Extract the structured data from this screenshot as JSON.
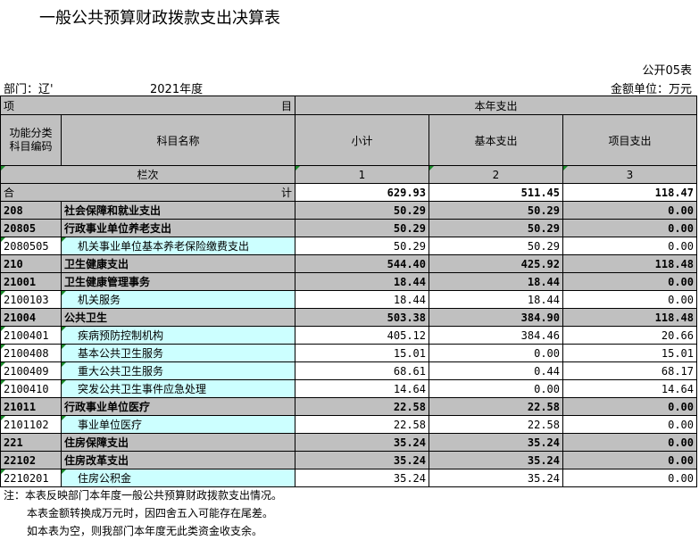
{
  "title": "一般公共预算财政拨款支出决算表",
  "public_no": "公开05表",
  "dept": "部门：辽'",
  "year": "2021年度",
  "unit": "金额单位：万元",
  "header": {
    "xiang": "项",
    "mu": "目",
    "current_year": "本年支出",
    "func_code_line1": "功能分类",
    "func_code_line2": "科目编码",
    "subject_name": "科目名称",
    "subtotal": "小计",
    "basic": "基本支出",
    "project": "项目支出",
    "lanci": "栏次",
    "col1": "1",
    "col2": "2",
    "col3": "3"
  },
  "total": {
    "he": "合",
    "ji": "计",
    "subtotal": "629.93",
    "basic": "511.45",
    "project": "118.47"
  },
  "rows": [
    {
      "code": "208",
      "name": "社会保障和就业支出",
      "subtotal": "50.29",
      "basic": "50.29",
      "project": "0.00",
      "level": 1
    },
    {
      "code": "20805",
      "name": "行政事业单位养老支出",
      "subtotal": "50.29",
      "basic": "50.29",
      "project": "0.00",
      "level": 2
    },
    {
      "code": "2080505",
      "name": "机关事业单位基本养老保险缴费支出",
      "subtotal": "50.29",
      "basic": "50.29",
      "project": "0.00",
      "level": 3
    },
    {
      "code": "210",
      "name": "卫生健康支出",
      "subtotal": "544.40",
      "basic": "425.92",
      "project": "118.48",
      "level": 1
    },
    {
      "code": "21001",
      "name": "卫生健康管理事务",
      "subtotal": "18.44",
      "basic": "18.44",
      "project": "0.00",
      "level": 2
    },
    {
      "code": "2100103",
      "name": "机关服务",
      "subtotal": "18.44",
      "basic": "18.44",
      "project": "0.00",
      "level": 3
    },
    {
      "code": "21004",
      "name": "公共卫生",
      "subtotal": "503.38",
      "basic": "384.90",
      "project": "118.48",
      "level": 2
    },
    {
      "code": "2100401",
      "name": "疾病预防控制机构",
      "subtotal": "405.12",
      "basic": "384.46",
      "project": "20.66",
      "level": 3
    },
    {
      "code": "2100408",
      "name": "基本公共卫生服务",
      "subtotal": "15.01",
      "basic": "0.00",
      "project": "15.01",
      "level": 3
    },
    {
      "code": "2100409",
      "name": "重大公共卫生服务",
      "subtotal": "68.61",
      "basic": "0.44",
      "project": "68.17",
      "level": 3
    },
    {
      "code": "2100410",
      "name": "突发公共卫生事件应急处理",
      "subtotal": "14.64",
      "basic": "0.00",
      "project": "14.64",
      "level": 3
    },
    {
      "code": "21011",
      "name": "行政事业单位医疗",
      "subtotal": "22.58",
      "basic": "22.58",
      "project": "0.00",
      "level": 2
    },
    {
      "code": "2101102",
      "name": "事业单位医疗",
      "subtotal": "22.58",
      "basic": "22.58",
      "project": "0.00",
      "level": 3
    },
    {
      "code": "221",
      "name": "住房保障支出",
      "subtotal": "35.24",
      "basic": "35.24",
      "project": "0.00",
      "level": 1
    },
    {
      "code": "22102",
      "name": "住房改革支出",
      "subtotal": "35.24",
      "basic": "35.24",
      "project": "0.00",
      "level": 2
    },
    {
      "code": "2210201",
      "name": "住房公积金",
      "subtotal": "35.24",
      "basic": "35.24",
      "project": "0.00",
      "level": 3
    }
  ],
  "notes": [
    "注：本表反映部门本年度一般公共预算财政拨款支出情况。",
    "本表金额转换成万元时，因四舍五入可能存在尾差。",
    "如本表为空，则我部门本年度无此类资金收支余。"
  ]
}
